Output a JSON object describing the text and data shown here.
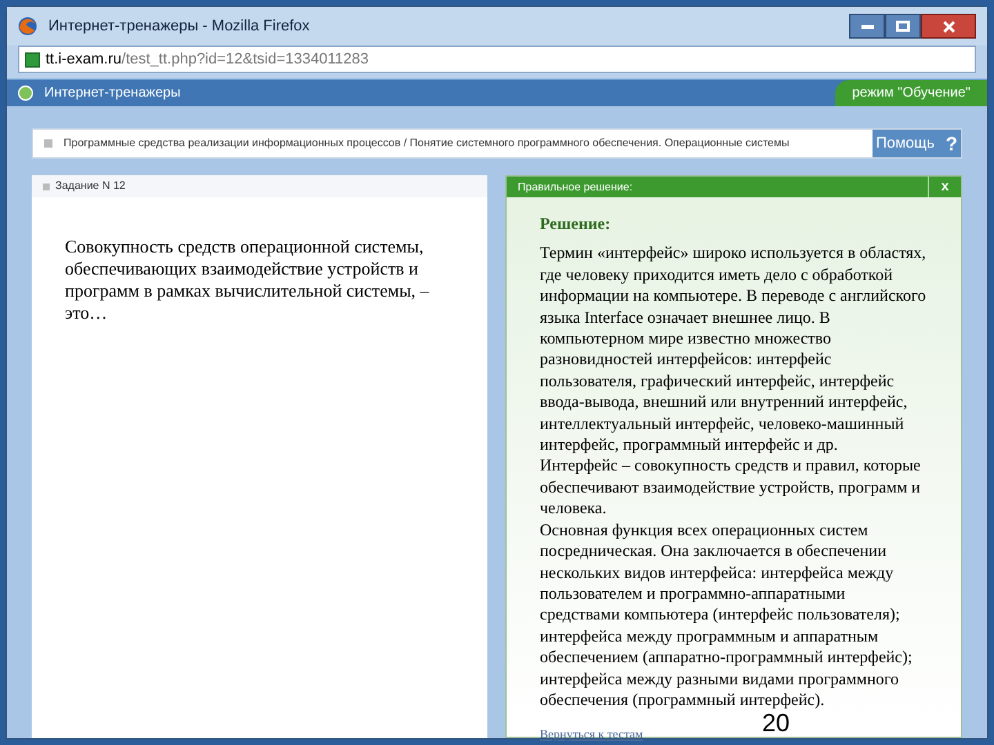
{
  "window": {
    "title": "Интернет-тренажеры - Mozilla Firefox"
  },
  "address_bar": {
    "url_host": "tt.i-exam.ru",
    "url_path": "/test_tt.php?id=12&tsid=1334011283"
  },
  "app_header": {
    "title": "Интернет-тренажеры",
    "mode": "режим \"Обучение\""
  },
  "breadcrumb": {
    "text": "Программные средства реализации информационных процессов / Понятие системного программного обеспечения. Операционные системы",
    "help_button": "Помощь",
    "help_icon": "?"
  },
  "task": {
    "header": "Задание N 12",
    "question": "Совокупность средств операционной системы, обеспечивающих взаимодействие устройств и программ в рамках вычислительной системы, – это…"
  },
  "solution_panel": {
    "header": "Правильное решение:",
    "close": "x",
    "heading": "Решение:",
    "paragraphs": [
      "Термин «интерфейс» широко используется в областях, где человеку приходится иметь дело с обработкой информации на компьютере. В переводе с английского языка Interface означает внешнее лицо. В компьютерном мире известно множество разновидностей интерфейсов: интерфейс пользователя, графический интерфейс, интерфейс ввода-вывода, внешний или внутренний интерфейс, интеллектуальный интерфейс, человеко-машинный интерфейс, программный интерфейс и др.",
      "Интерфейс – совокупность средств и правил, которые обеспечивают взаимодействие устройств, программ и человека.",
      "Основная функция всех операционных систем посредническая. Она заключается в обеспечении нескольких видов интерфейса: интерфейса между пользователем и программно-аппаратными средствами компьютера (интерфейс пользователя); интерфейса между программным и аппаратным обеспечением (аппаратно-программный интерфейс); интерфейса между разными видами программного обеспечения (программный интерфейс)."
    ],
    "back_link": "Вернуться к тестам"
  },
  "slide_number": "20"
}
